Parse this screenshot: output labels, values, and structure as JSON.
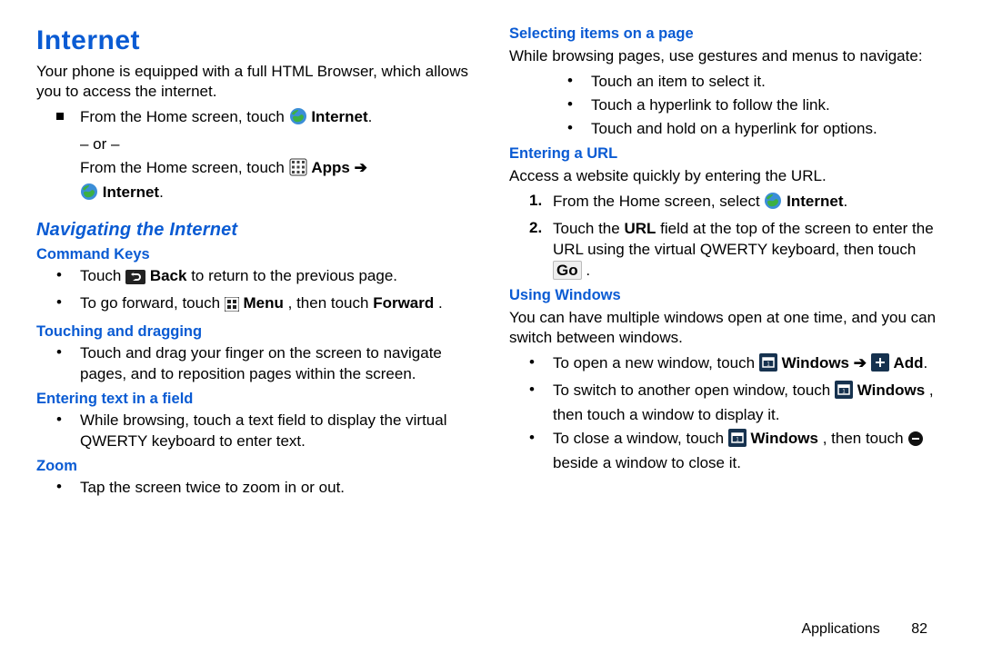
{
  "title": "Internet",
  "intro": "Your phone is equipped with a full HTML Browser, which allows you to access the internet.",
  "launch": {
    "prefix": "From the Home screen, touch ",
    "internet_label": "Internet",
    "or": "– or –",
    "apps_label": "Apps",
    "arrow": "➔"
  },
  "nav_heading": "Navigating the Internet",
  "cmd": {
    "heading": "Command Keys",
    "back_pre": "Touch ",
    "back_bold": "Back",
    "back_post": " to return to the previous page.",
    "fwd_pre": "To go forward, touch ",
    "menu_bold": "Menu",
    "fwd_mid": ", then touch ",
    "fwd_bold": "Forward",
    "fwd_post": "."
  },
  "touchdrag": {
    "heading": "Touching and dragging",
    "text": "Touch and drag your finger on the screen to navigate pages, and to reposition pages within the screen."
  },
  "enterfield": {
    "heading": "Entering text in a field",
    "text": "While browsing, touch a text field to display the virtual QWERTY keyboard to enter text."
  },
  "zoom": {
    "heading": "Zoom",
    "text": "Tap the screen twice to zoom in or out."
  },
  "select": {
    "heading": "Selecting items on a page",
    "intro": "While browsing pages, use gestures and menus to navigate:",
    "b1": "Touch an item to select it.",
    "b2": "Touch a hyperlink to follow the link.",
    "b3": "Touch and hold on a hyperlink for options."
  },
  "url": {
    "heading": "Entering a URL",
    "intro": "Access a website quickly by entering the URL.",
    "s1_pre": "From the Home screen, select ",
    "s1_bold": "Internet",
    "s2_pre": "Touch the ",
    "s2_bold": "URL",
    "s2_mid": " field at the top of the screen to enter the URL using the virtual QWERTY keyboard, then touch ",
    "s2_go": "Go",
    "s2_post": "."
  },
  "windows": {
    "heading": "Using Windows",
    "intro": "You can have multiple windows open at one time, and you can switch between windows.",
    "open_pre": "To open a new window, touch ",
    "win_bold": "Windows",
    "add_bold": "Add",
    "switch_pre": "To switch to another open window, touch ",
    "switch_post": ", then touch a window to display it.",
    "close_pre": "To close a window, touch ",
    "close_mid": ", then touch ",
    "close_post": " beside a window to close it."
  },
  "footer": {
    "section": "Applications",
    "page": "82"
  }
}
